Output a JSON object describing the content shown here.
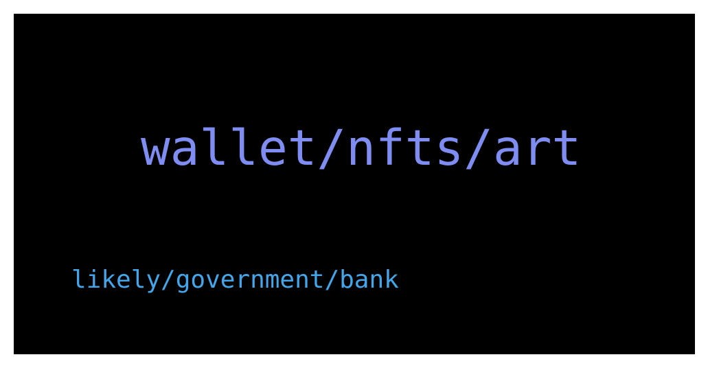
{
  "slide": {
    "primary_text": "wallet/nfts/art",
    "secondary_text": "likely/government/bank",
    "colors": {
      "background": "#000000",
      "primary_text": "#7f8cf2",
      "secondary_text": "#43a6ea",
      "frame": "#ffffff"
    }
  }
}
